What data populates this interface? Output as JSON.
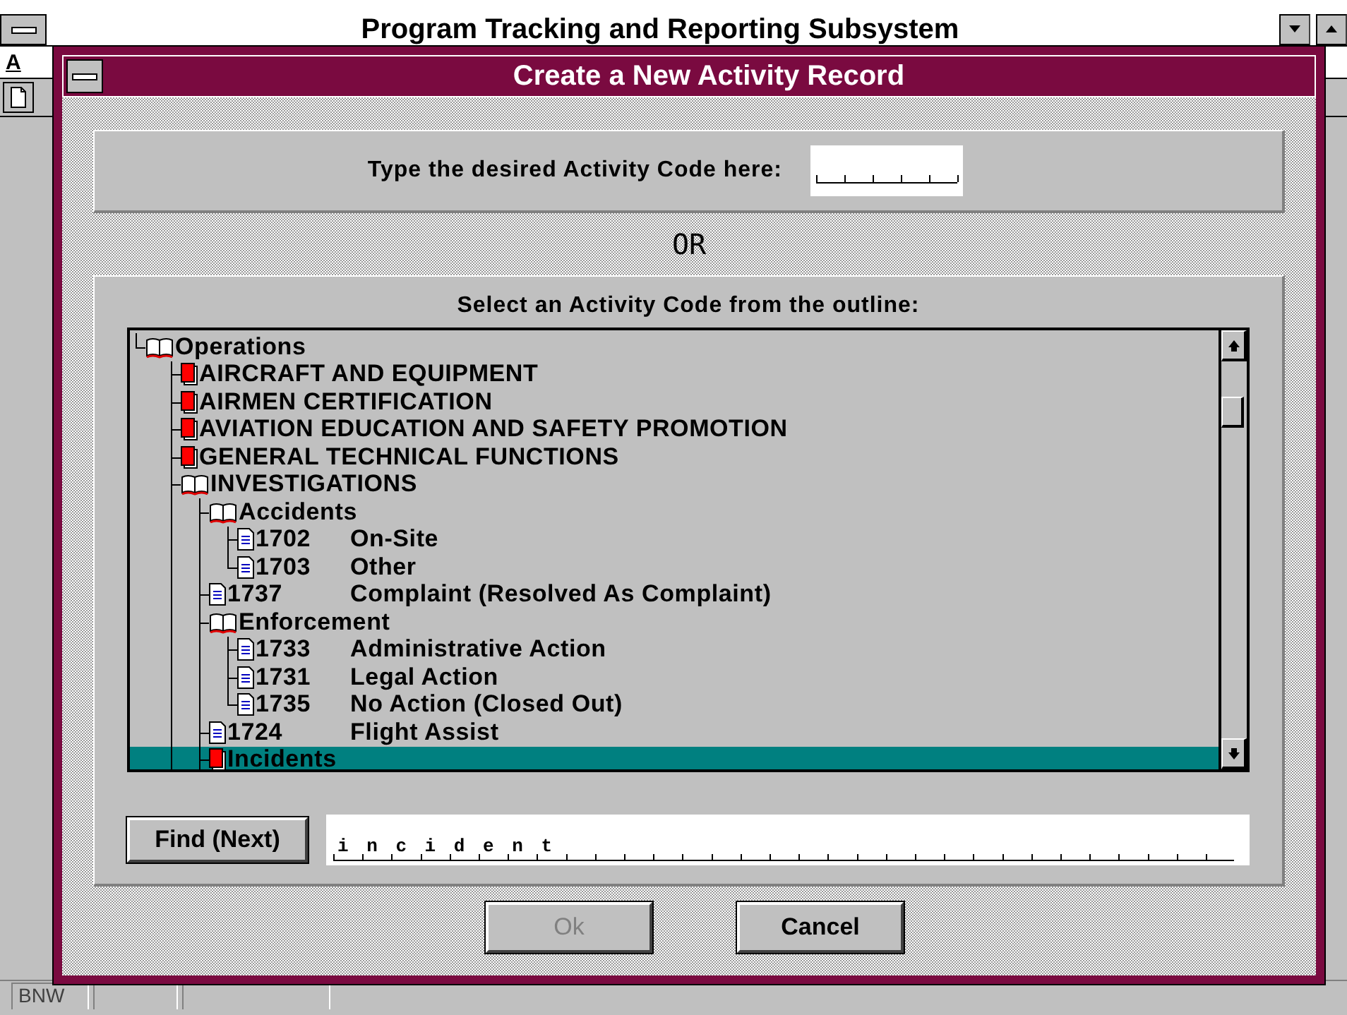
{
  "app_window": {
    "title": "Program Tracking and Reporting Subsystem",
    "menu": [
      "A"
    ],
    "status_bar": [
      "BNW"
    ]
  },
  "dialog": {
    "title": "Create a New Activity Record",
    "code_entry": {
      "label": "Type the desired Activity Code here:"
    },
    "separator": "OR",
    "outline": {
      "label": "Select an Activity Code from the outline:",
      "nodes": [
        {
          "kind": "folder",
          "label": "Operations",
          "expanded": true,
          "selected": false,
          "more_below": true,
          "children": [
            {
              "kind": "folder",
              "label": "AIRCRAFT AND EQUIPMENT",
              "expanded": false,
              "selected": false
            },
            {
              "kind": "folder",
              "label": "AIRMEN CERTIFICATION",
              "expanded": false,
              "selected": false
            },
            {
              "kind": "folder",
              "label": "AVIATION EDUCATION AND SAFETY PROMOTION",
              "expanded": false,
              "selected": false
            },
            {
              "kind": "folder",
              "label": "GENERAL TECHNICAL FUNCTIONS",
              "expanded": false,
              "selected": false
            },
            {
              "kind": "folder",
              "label": "INVESTIGATIONS",
              "expanded": true,
              "selected": false,
              "more_below": true,
              "children": [
                {
                  "kind": "folder",
                  "label": "Accidents",
                  "expanded": true,
                  "selected": false,
                  "children": [
                    {
                      "kind": "activity",
                      "code": "1702",
                      "label": "On-Site",
                      "selected": false
                    },
                    {
                      "kind": "activity",
                      "code": "1703",
                      "label": "Other",
                      "selected": false
                    }
                  ]
                },
                {
                  "kind": "activity",
                  "code": "1737",
                  "label": "Complaint (Resolved As Complaint)",
                  "selected": false
                },
                {
                  "kind": "folder",
                  "label": "Enforcement",
                  "expanded": true,
                  "selected": false,
                  "children": [
                    {
                      "kind": "activity",
                      "code": "1733",
                      "label": "Administrative Action",
                      "selected": false
                    },
                    {
                      "kind": "activity",
                      "code": "1731",
                      "label": "Legal Action",
                      "selected": false
                    },
                    {
                      "kind": "activity",
                      "code": "1735",
                      "label": "No Action (Closed Out)",
                      "selected": false
                    }
                  ]
                },
                {
                  "kind": "activity",
                  "code": "1724",
                  "label": "Flight Assist",
                  "selected": false
                },
                {
                  "kind": "folder",
                  "label": "Incidents",
                  "expanded": false,
                  "selected": true
                }
              ]
            }
          ]
        }
      ]
    },
    "find": {
      "button": "Find (Next)",
      "value": "incident"
    },
    "buttons": [
      {
        "label": "Ok",
        "disabled": true
      },
      {
        "label": "Cancel",
        "disabled": false
      }
    ]
  }
}
